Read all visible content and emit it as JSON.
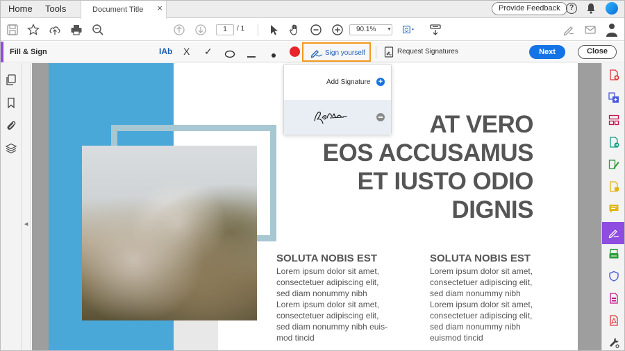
{
  "tabbar": {
    "home": "Home",
    "tools": "Tools",
    "document_tab": "Document Title",
    "close_tab": "×",
    "feedback": "Provide Feedback",
    "help": "?"
  },
  "toolbar": {
    "icons": [
      "save-icon",
      "bookmark-star-icon",
      "upload-icon",
      "print-icon",
      "search-zoom-icon",
      "page-up-icon",
      "page-down-icon",
      "select-cursor-icon",
      "hand-icon",
      "zoom-out-icon",
      "zoom-in-icon",
      "fit-page-icon",
      "scroll-mode-icon",
      "sign-pen-icon",
      "mail-icon",
      "user-avatar-icon"
    ],
    "page_current": "1",
    "page_total": "/ 1",
    "zoom": "90.1%"
  },
  "fill_sign": {
    "title": "Fill & Sign",
    "text_tool": "IAb",
    "cross_tool": "X",
    "check_tool": "✓",
    "sign_yourself": "Sign yourself",
    "request_signatures": "Request Signatures",
    "next": "Next",
    "close": "Close",
    "colors": {
      "accent": "#8e4ce0",
      "highlight": "#f39a1e",
      "dot": "#e8232b",
      "primary": "#1473e6"
    }
  },
  "dropdown": {
    "add_signature": "Add Signature"
  },
  "document": {
    "heading_lines": [
      "AT VERO",
      "EOS ACCUSAMUS",
      "ET IUSTO ODIO",
      "DIGNIS"
    ],
    "columns": [
      {
        "title": "SOLUTA NOBIS EST",
        "body_lines": [
          "Lorem ipsum dolor sit amet,",
          "consectetuer adipiscing elit,",
          "sed diam nonummy nibh",
          "Lorem ipsum dolor sit amet,",
          "consectetuer adipiscing elit,",
          "sed diam nonummy nibh euis-",
          "mod tincid"
        ]
      },
      {
        "title": "SOLUTA NOBIS EST",
        "body_lines": [
          "Lorem ipsum dolor sit amet,",
          "consectetuer adipiscing elit,",
          "sed diam nonummy nibh",
          "Lorem ipsum dolor sit amet,",
          "consectetuer adipiscing elit,",
          "sed diam nonummy nibh",
          "euismod tincid"
        ]
      }
    ]
  }
}
